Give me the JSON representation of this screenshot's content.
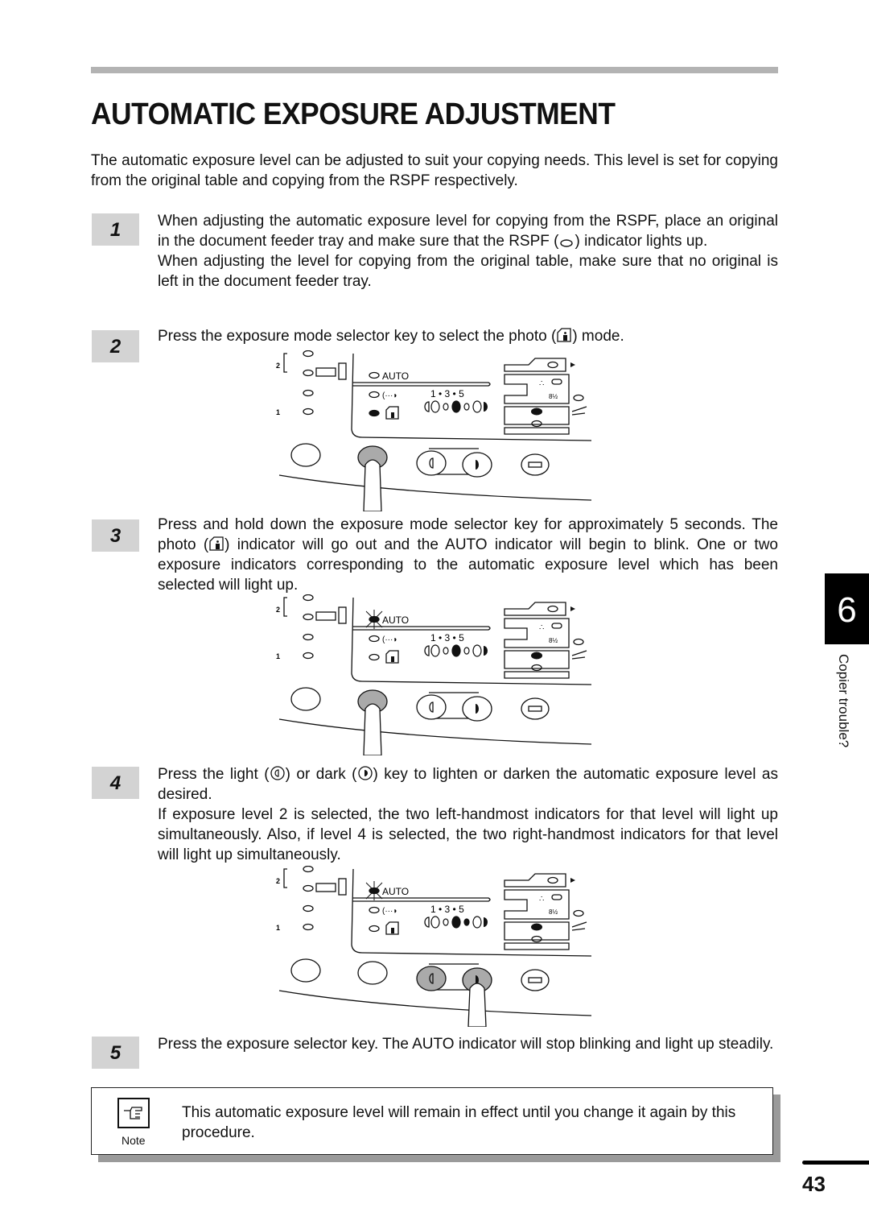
{
  "page": {
    "title": "AUTOMATIC EXPOSURE ADJUSTMENT",
    "intro": "The automatic exposure level can be adjusted to suit your copying needs. This level is set for copying from the original table and copying from the RSPF respectively.",
    "chapter_number": "6",
    "chapter_label": "Copier trouble?",
    "page_number": "43"
  },
  "steps": [
    {
      "number": "1",
      "paragraphs": [
        {
          "before": "When adjusting the automatic exposure level for copying from the RSPF, place an original in the document feeder tray and make sure that the RSPF (",
          "icon": "rspf-indicator-icon",
          "after": ") indicator lights up."
        },
        {
          "before": "When adjusting the level for copying from the original table, make sure that no original is left in the document feeder tray.",
          "icon": "",
          "after": ""
        }
      ]
    },
    {
      "number": "2",
      "paragraphs": [
        {
          "before": "Press the exposure mode selector key to select the photo (",
          "icon": "photo-mode-icon",
          "after": ") mode."
        }
      ]
    },
    {
      "number": "3",
      "paragraphs": [
        {
          "before": "Press and hold down the exposure mode selector key for approximately 5 seconds. The photo (",
          "icon": "photo-mode-icon",
          "after": ") indicator will go out and the AUTO indicator will begin to blink. One or two exposure indicators corresponding to the automatic exposure level which has been selected will light up."
        }
      ]
    },
    {
      "number": "4",
      "paragraphs": [
        {
          "before": "Press the light (",
          "icon": "light-key-icon",
          "middle": ") or dark (",
          "icon2": "dark-key-icon",
          "after": ") key to lighten or darken the automatic exposure level as desired."
        },
        {
          "before": "If exposure level 2 is selected, the two left-handmost indicators for that level will light up simultaneously. Also, if level 4 is selected, the two right-handmost indicators for that level will light up simultaneously.",
          "icon": "",
          "after": ""
        }
      ]
    },
    {
      "number": "5",
      "paragraphs": [
        {
          "before": "Press the exposure selector key. The AUTO indicator will stop blinking and light up steadily.",
          "icon": "",
          "after": ""
        }
      ]
    }
  ],
  "panels": [
    {
      "step": "2",
      "auto_label": "AUTO",
      "scale_label": "1 • 3 • 5",
      "auto_state": "off",
      "photo_state": "on",
      "lit_levels": [
        3
      ],
      "pressed": [
        "exposure-mode-key"
      ]
    },
    {
      "step": "3",
      "auto_label": "AUTO",
      "scale_label": "1 • 3 • 5",
      "auto_state": "blinking",
      "photo_state": "off",
      "lit_levels": [
        3
      ],
      "pressed": [
        "exposure-mode-key"
      ]
    },
    {
      "step": "4",
      "auto_label": "AUTO",
      "scale_label": "1 • 3 • 5",
      "auto_state": "blinking",
      "photo_state": "off",
      "lit_levels": [
        3,
        4
      ],
      "pressed": [
        "light-key",
        "dark-key"
      ]
    }
  ],
  "note": {
    "label": "Note",
    "text": "This automatic exposure level will remain in effect until you change it again by this procedure."
  }
}
